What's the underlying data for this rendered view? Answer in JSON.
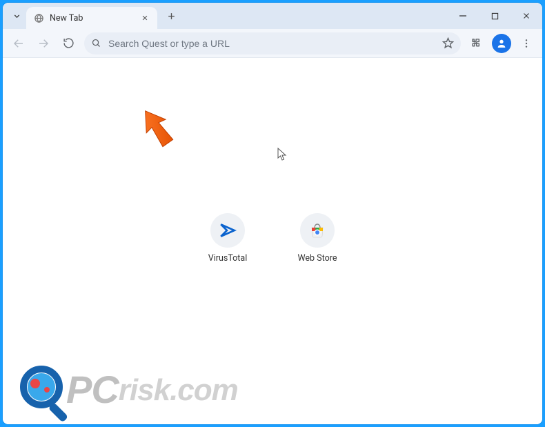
{
  "tab": {
    "title": "New Tab"
  },
  "omnibox": {
    "placeholder": "Search Quest or type a URL",
    "value": ""
  },
  "shortcuts": [
    {
      "label": "VirusTotal",
      "icon": "virustotal"
    },
    {
      "label": "Web Store",
      "icon": "webstore"
    }
  ],
  "watermark": {
    "text_primary": "PC",
    "text_secondary": "risk.com"
  }
}
